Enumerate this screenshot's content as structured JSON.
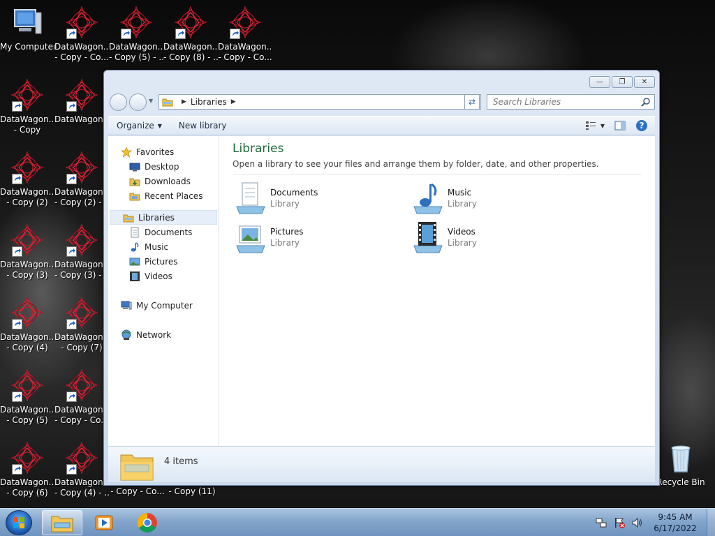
{
  "desktop": {
    "icons": [
      {
        "label1": "My Computer",
        "label2": "",
        "kind": "computer",
        "shortcut": false
      },
      {
        "label1": "DataWagon....",
        "label2": "- Copy - Co...",
        "kind": "datawagon",
        "shortcut": true
      },
      {
        "label1": "DataWagon....",
        "label2": "- Copy (5) - ...",
        "kind": "datawagon",
        "shortcut": true
      },
      {
        "label1": "DataWagon....",
        "label2": "- Copy (8) - ...",
        "kind": "datawagon",
        "shortcut": true
      },
      {
        "label1": "DataWagon....",
        "label2": "- Copy - Co...",
        "kind": "datawagon",
        "shortcut": true
      },
      {
        "label1": "DataWagon....",
        "label2": "- Copy",
        "kind": "datawagon",
        "shortcut": true
      },
      {
        "label1": "DataWagon....",
        "label2": "",
        "kind": "datawagon",
        "shortcut": true
      },
      {
        "label1": "DataWagon....",
        "label2": "- Copy (2)",
        "kind": "datawagon",
        "shortcut": true
      },
      {
        "label1": "DataWagon....",
        "label2": "- Copy (2) - ...",
        "kind": "datawagon",
        "shortcut": true
      },
      {
        "label1": "DataWagon....",
        "label2": "- Copy (3)",
        "kind": "datawagon",
        "shortcut": true
      },
      {
        "label1": "DataWagon....",
        "label2": "- Copy (3) - ...",
        "kind": "datawagon",
        "shortcut": true
      },
      {
        "label1": "DataWagon....",
        "label2": "- Copy (4)",
        "kind": "datawagon",
        "shortcut": true
      },
      {
        "label1": "DataWagon....",
        "label2": "- Copy (7)",
        "kind": "datawagon",
        "shortcut": true
      },
      {
        "label1": "DataWagon....",
        "label2": "- Copy (5)",
        "kind": "datawagon",
        "shortcut": true
      },
      {
        "label1": "DataWagon....",
        "label2": "- Copy - Co...",
        "kind": "datawagon",
        "shortcut": true
      },
      {
        "label1": "DataWagon....",
        "label2": "- Copy (6)",
        "kind": "datawagon",
        "shortcut": true
      },
      {
        "label1": "DataWagon....",
        "label2": "- Copy (4) - ...",
        "kind": "datawagon",
        "shortcut": true
      }
    ],
    "bottom_labels": [
      "- Copy - Co...",
      "- Copy (11)"
    ],
    "recycle_bin": "Recycle Bin"
  },
  "window": {
    "address": {
      "crumb": "Libraries"
    },
    "search": {
      "placeholder": "Search Libraries"
    },
    "toolbar": {
      "organize": "Organize",
      "new_library": "New library"
    },
    "nav": {
      "favorites": "Favorites",
      "favorites_items": [
        "Desktop",
        "Downloads",
        "Recent Places"
      ],
      "libraries": "Libraries",
      "libraries_items": [
        "Documents",
        "Music",
        "Pictures",
        "Videos"
      ],
      "computer": "My Computer",
      "network": "Network"
    },
    "content": {
      "title": "Libraries",
      "description": "Open a library to see your files and arrange them by folder, date, and other properties.",
      "libraries": [
        {
          "name": "Documents",
          "kind": "Library",
          "icon": "documents-library-icon"
        },
        {
          "name": "Music",
          "kind": "Library",
          "icon": "music-library-icon"
        },
        {
          "name": "Pictures",
          "kind": "Library",
          "icon": "pictures-library-icon"
        },
        {
          "name": "Videos",
          "kind": "Library",
          "icon": "videos-library-icon"
        }
      ]
    },
    "details": {
      "count": "4 items"
    }
  },
  "taskbar": {
    "clock_time": "9:45 AM",
    "clock_date": "6/17/2022",
    "pinned": [
      "file-explorer-icon",
      "media-player-icon",
      "chrome-icon"
    ]
  }
}
